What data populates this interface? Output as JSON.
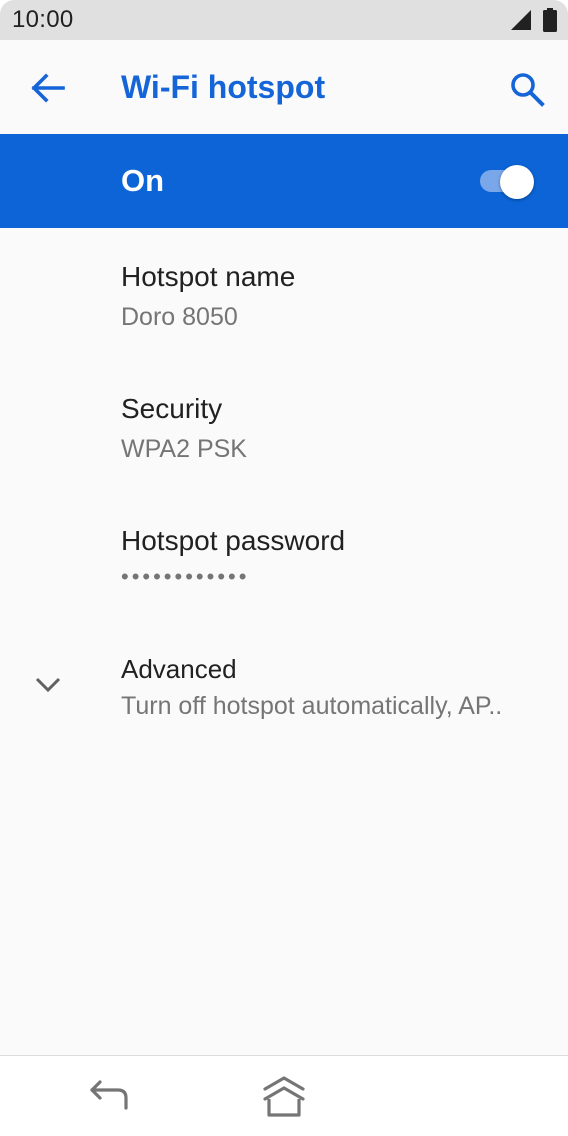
{
  "status_bar": {
    "time": "10:00",
    "icons": [
      "signal-icon",
      "battery-icon"
    ]
  },
  "app_bar": {
    "title": "Wi-Fi hotspot",
    "back_icon": "arrow-back-icon",
    "search_icon": "search-icon"
  },
  "master_switch": {
    "label": "On",
    "checked": true
  },
  "preferences": [
    {
      "title": "Hotspot name",
      "summary": "Doro 8050"
    },
    {
      "title": "Security",
      "summary": "WPA2 PSK"
    },
    {
      "title": "Hotspot password",
      "summary": "••••••••••••"
    },
    {
      "title": "Advanced",
      "summary": "Turn off hotspot automatically, AP.."
    }
  ],
  "nav_bar": {
    "icons": [
      "back-icon",
      "home-icon"
    ]
  },
  "colors": {
    "accent": "#1565d8",
    "switch_bar": "#0c64d6",
    "status_bar": "#e0e0e0",
    "background": "#fafafa",
    "text_primary": "#212121",
    "text_secondary": "#757575"
  }
}
